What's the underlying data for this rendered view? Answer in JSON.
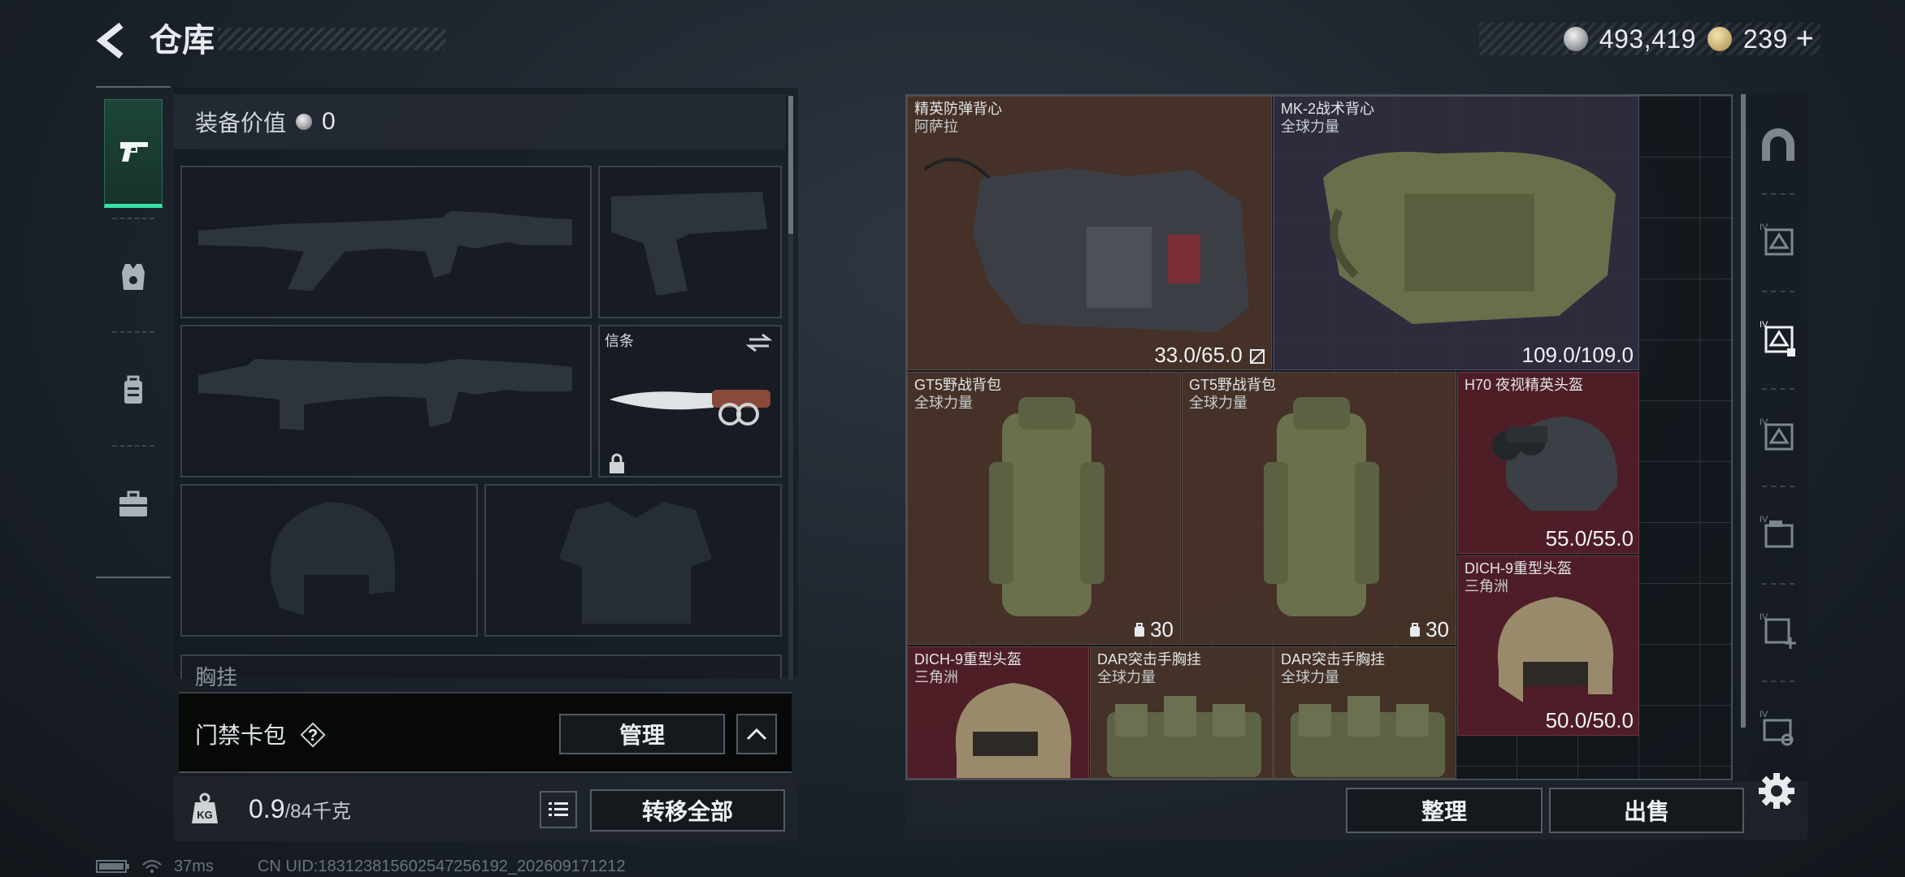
{
  "header": {
    "title": "仓库",
    "currency": [
      {
        "icon": "silver-coin-icon",
        "value": "493,419"
      },
      {
        "icon": "gold-coin-icon",
        "value": "239"
      }
    ],
    "add_label": "+"
  },
  "left_nav": {
    "items": [
      {
        "icon": "pistol-icon",
        "active": true
      },
      {
        "icon": "vest-icon",
        "active": false
      },
      {
        "icon": "backpack-icon",
        "active": false
      },
      {
        "icon": "case-icon",
        "active": false
      }
    ]
  },
  "equipment": {
    "value_label": "装备价值",
    "value": "0",
    "slots": [
      {
        "kind": "primary-weapon",
        "empty": true
      },
      {
        "kind": "pistol",
        "empty": true
      },
      {
        "kind": "secondary-weapon",
        "empty": true
      },
      {
        "kind": "melee",
        "empty": false,
        "label": "信条"
      },
      {
        "kind": "helmet",
        "empty": true
      },
      {
        "kind": "armor",
        "empty": true
      }
    ],
    "partial_label": "胸挂"
  },
  "keycard": {
    "label": "门禁卡包",
    "help": "?",
    "manage_label": "管理"
  },
  "footer_left": {
    "weight_value": "0.9",
    "weight_max": "/84千克",
    "transfer_label": "转移全部"
  },
  "stash": {
    "items": [
      {
        "name": "精英防弹背心",
        "sub": "阿萨拉",
        "durability": "33.0/65.0",
        "color": "brown"
      },
      {
        "name": "MK-2战术背心",
        "sub": "全球力量",
        "durability": "109.0/109.0",
        "color": "purple"
      },
      {
        "name": "GT5野战背包",
        "sub": "全球力量",
        "capacity": "30",
        "color": "brown"
      },
      {
        "name": "GT5野战背包",
        "sub": "全球力量",
        "capacity": "30",
        "color": "brown"
      },
      {
        "name": "H70 夜视精英头盔",
        "sub": "",
        "durability": "55.0/55.0",
        "color": "red"
      },
      {
        "name": "DICH-9重型头盔",
        "sub": "三角洲",
        "durability": "50.0/50.0",
        "color": "red"
      },
      {
        "name": "DICH-9重型头盔",
        "sub": "三角洲",
        "color": "red"
      },
      {
        "name": "DAR突击手胸挂",
        "sub": "全球力量",
        "color": "brown"
      },
      {
        "name": "DAR突击手胸挂",
        "sub": "全球力量",
        "color": "brown"
      }
    ],
    "sort_label": "整理",
    "sell_label": "出售"
  },
  "right_rail": {
    "items": [
      "home-icon",
      "storage-1-icon",
      "storage-2-icon",
      "storage-3-icon",
      "storage-4-icon",
      "storage-add-icon",
      "storage-settings-icon"
    ]
  },
  "status": {
    "ping": "37ms",
    "uid": "CN UID:18312381560254725619​2_202609171212"
  }
}
